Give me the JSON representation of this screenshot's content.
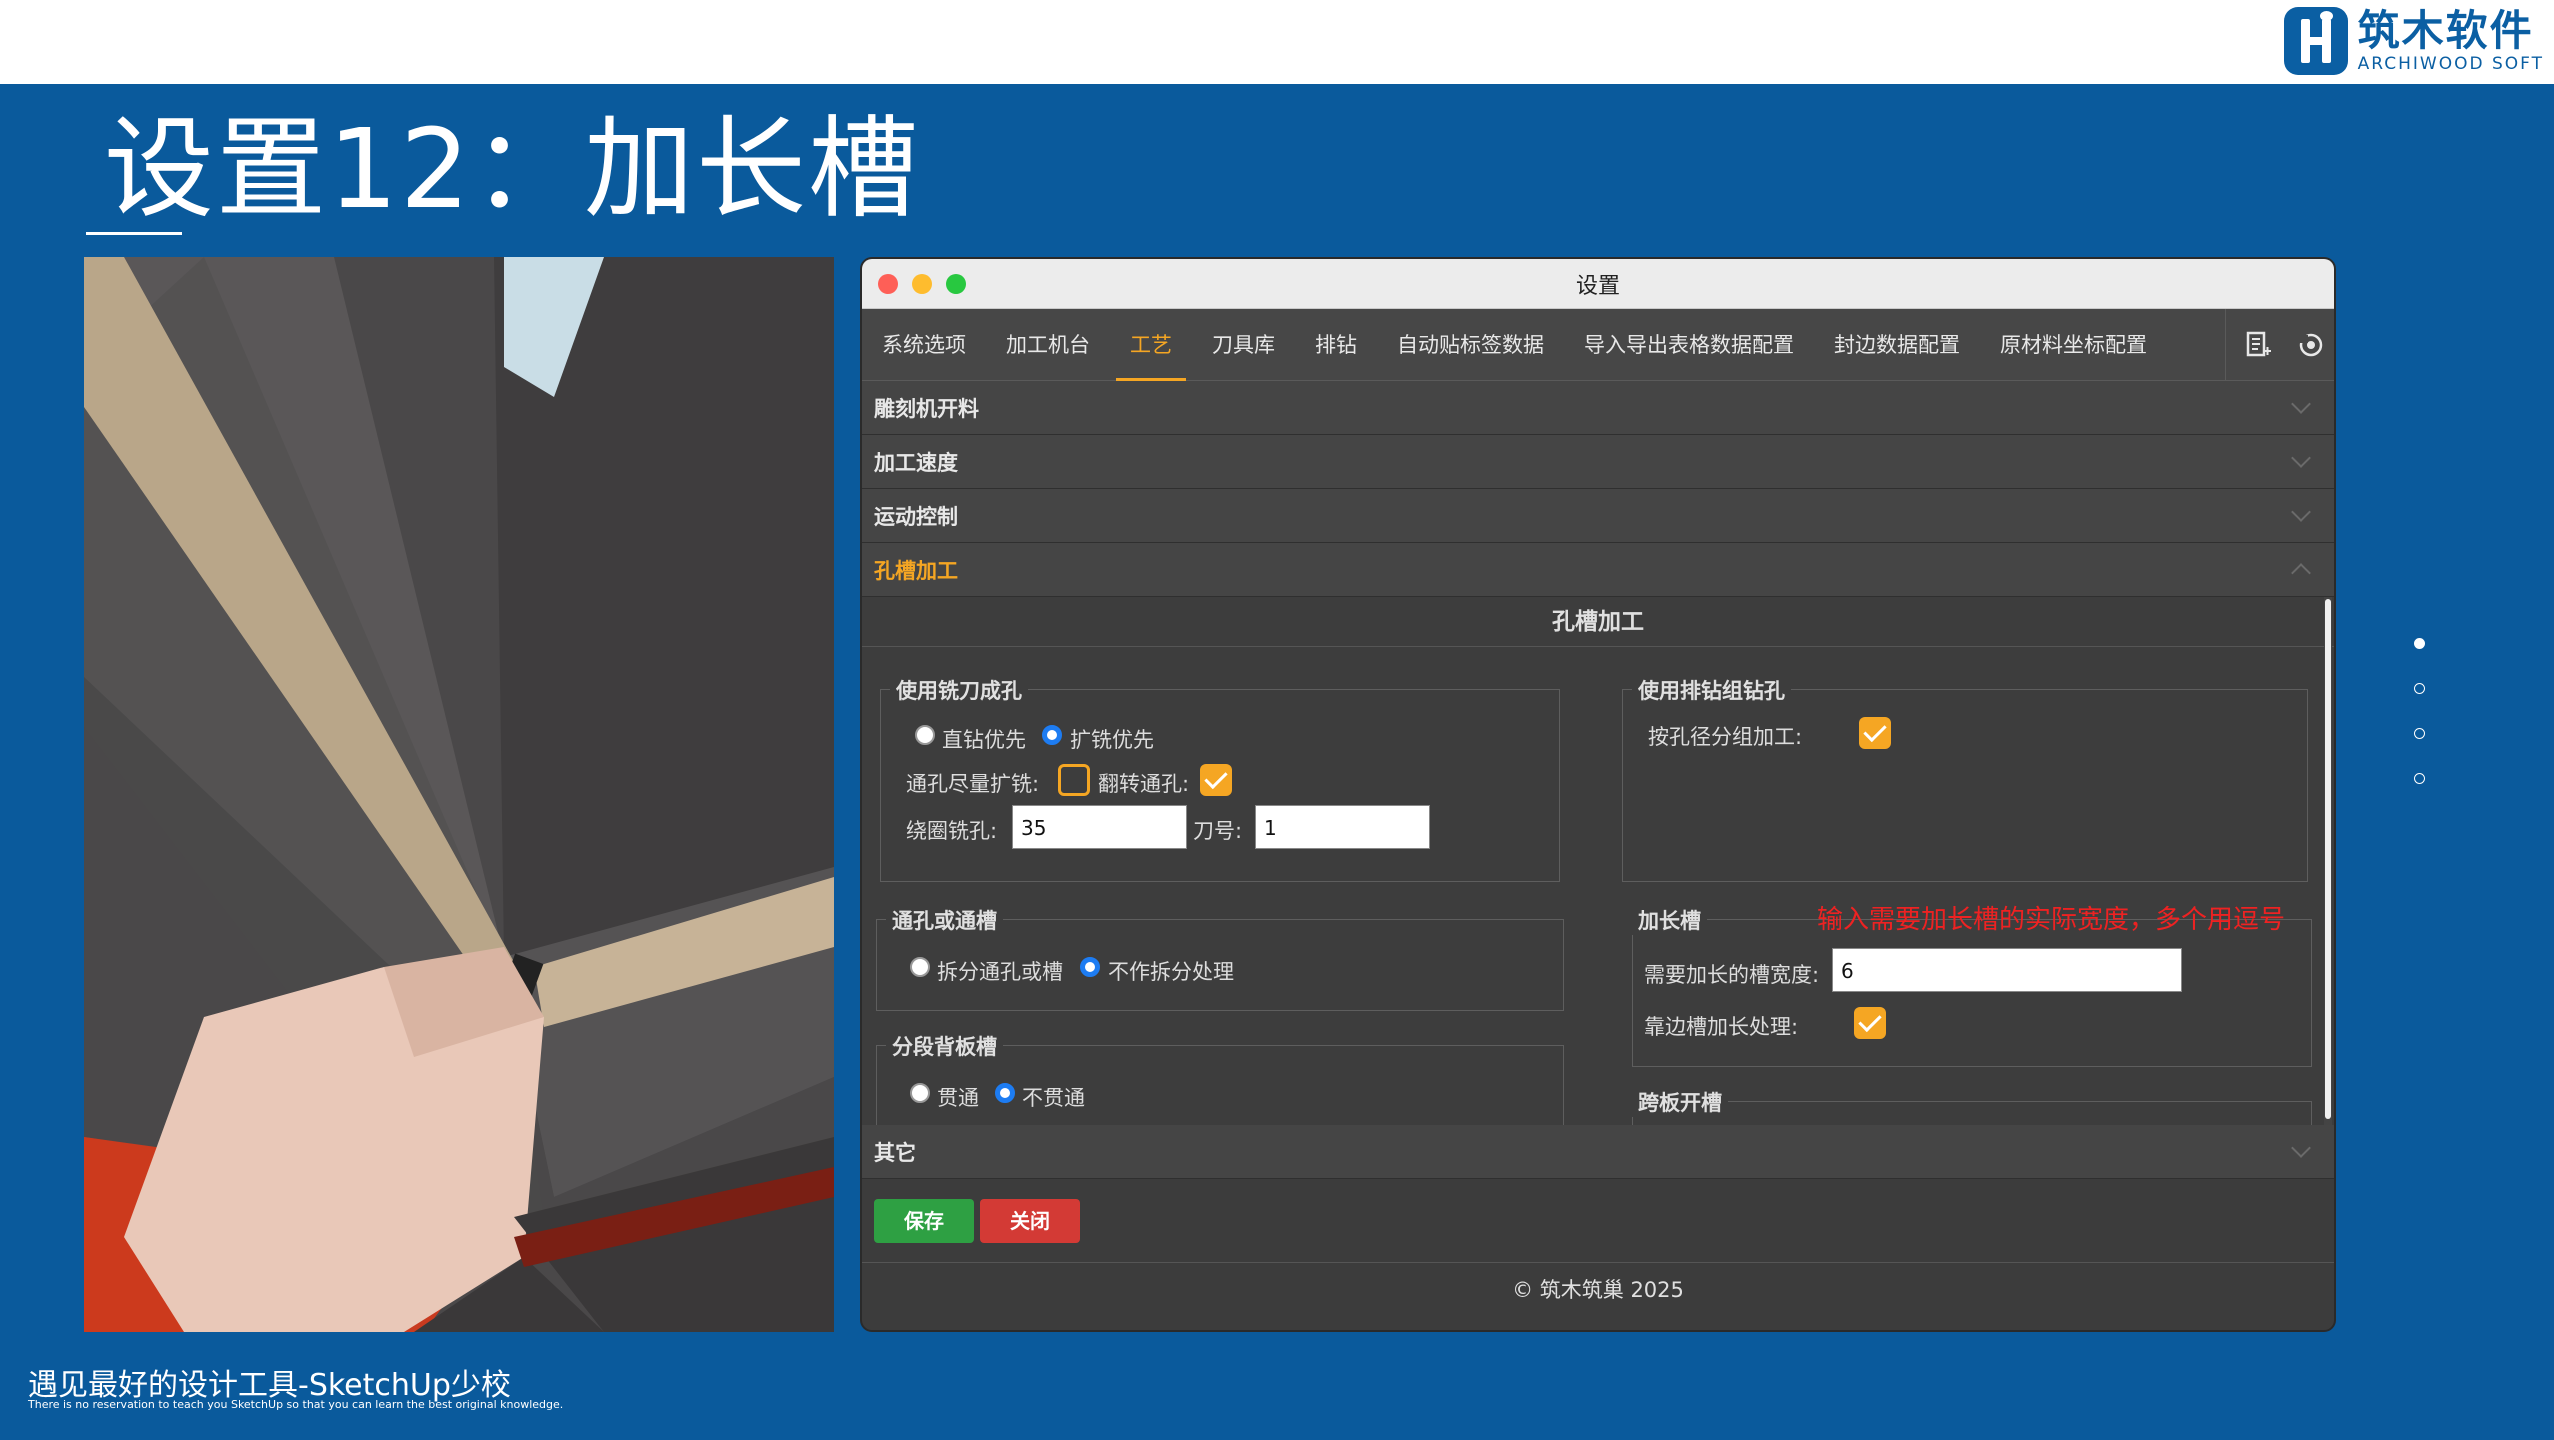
{
  "brand": {
    "cn": "筑木软件",
    "en": "ARCHIWOOD SOFT",
    "color": "#0b5fa3"
  },
  "slide": {
    "title": "设置12：加长槽"
  },
  "window": {
    "title": "设置"
  },
  "tabs": [
    "系统选项",
    "加工机台",
    "工艺",
    "刀具库",
    "排钻",
    "自动贴标签数据",
    "导入导出表格数据配置",
    "封边数据配置",
    "原材料坐标配置"
  ],
  "active_tab": "工艺",
  "accordion": {
    "items_top": [
      "雕刻机开料",
      "加工速度",
      "运动控制"
    ],
    "open_item": "孔槽加工",
    "bottom_item": "其它"
  },
  "panel": {
    "title": "孔槽加工",
    "mill_hole": {
      "legend": "使用铣刀成孔",
      "opt_drill_first": "直钻优先",
      "opt_mill_first": "扩铣优先",
      "through_mill_label": "通孔尽量扩铣:",
      "flip_through_label": "翻转通孔:",
      "circle_mill_label": "绕圈铣孔:",
      "circle_mill_value": "35",
      "tool_no_label": "刀号:",
      "tool_no_value": "1"
    },
    "gang_drill": {
      "legend": "使用排钻组钻孔",
      "group_by_dia_label": "按孔径分组加工:"
    },
    "through": {
      "legend": "通孔或通槽",
      "opt_split": "拆分通孔或槽",
      "opt_no_split": "不作拆分处理"
    },
    "back_panel": {
      "legend": "分段背板槽",
      "opt_through": "贯通",
      "opt_not_through": "不贯通"
    },
    "extend_slot": {
      "legend": "加长槽",
      "width_label": "需要加长的槽宽度:",
      "width_value": "6",
      "edge_label": "靠边槽加长处理:"
    },
    "cross_slot": {
      "legend": "跨板开槽"
    },
    "annotation": "输入需要加长槽的实际宽度，多个用逗号"
  },
  "buttons": {
    "save": "保存",
    "close": "关闭"
  },
  "footer": "© 筑木筑巢 2025",
  "bottom": {
    "cn": "遇见最好的设计工具-SketchUp少校",
    "en": "There is no reservation to teach you SketchUp so that you can learn the best original knowledge."
  },
  "colors": {
    "background": "#0a5a9c",
    "accent": "#f5a623",
    "save": "#2ea043",
    "close": "#d33a35"
  }
}
